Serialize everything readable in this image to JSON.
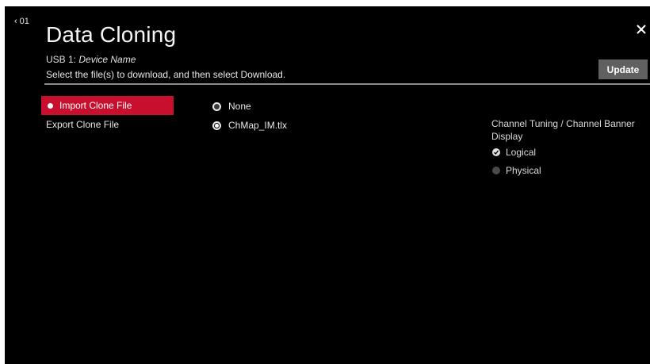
{
  "header": {
    "back_label": "01",
    "title": "Data Cloning",
    "device_prefix": "USB 1: ",
    "device_name": "Device Name",
    "instruction": "Select the file(s) to download, and then select Download.",
    "update_label": "Update"
  },
  "menu": {
    "items": [
      {
        "label": "Import Clone File",
        "active": true
      },
      {
        "label": "Export Clone File",
        "active": false
      }
    ]
  },
  "files": {
    "items": [
      {
        "label": "None",
        "selected": false
      },
      {
        "label": "ChMap_IM.tlx",
        "selected": true
      }
    ]
  },
  "options": {
    "heading": "Channel Tuning / Channel Banner Display",
    "items": [
      {
        "label": "Logical",
        "checked": true
      },
      {
        "label": "Physical",
        "checked": false
      }
    ]
  },
  "colors": {
    "accent": "#c8102e",
    "background": "#000000",
    "button": "#606060"
  },
  "icons": {
    "back": "chevron-left-icon",
    "close": "close-icon"
  }
}
